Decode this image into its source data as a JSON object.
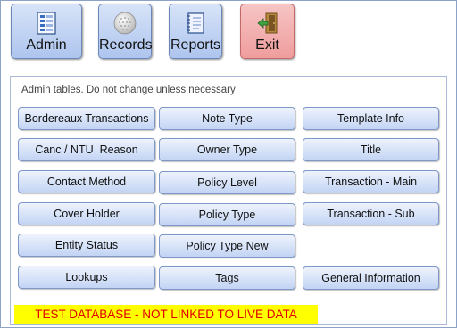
{
  "toolbar": {
    "admin_label": "Admin",
    "records_label": "Records",
    "reports_label": "Reports",
    "exit_label": "Exit"
  },
  "panel": {
    "title": "Admin tables. Do not change unless necessary",
    "col1": [
      "Bordereaux Transactions",
      "Canc / NTU  Reason",
      "Contact Method",
      "Cover Holder",
      "Entity Status",
      "Lookups"
    ],
    "col2": [
      "Note Type",
      "Owner Type",
      "Policy Level",
      "Policy Type",
      "Policy Type New",
      "Tags"
    ],
    "col3": [
      "Template Info",
      "Title",
      "Transaction - Main",
      "Transaction - Sub",
      "General Information"
    ]
  },
  "banner": "TEST DATABASE - NOT LINKED TO LIVE DATA",
  "colors": {
    "button_blue": "#c2d4f4",
    "exit_red": "#ef9d9d",
    "banner_bg": "#ffff00",
    "banner_text": "#e00000"
  }
}
